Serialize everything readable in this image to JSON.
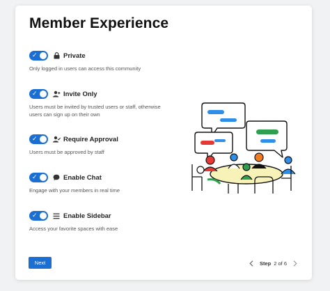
{
  "title": "Member Experience",
  "settings": [
    {
      "key": "private",
      "label": "Private",
      "icon": "lock-icon",
      "enabled": true,
      "description": "Only logged in users can access this community"
    },
    {
      "key": "invite-only",
      "label": "Invite Only",
      "icon": "user-plus-icon",
      "enabled": true,
      "description": "Users must be invited by trusted users or staff, otherwise users can sign up on their own"
    },
    {
      "key": "require-approval",
      "label": "Require Approval",
      "icon": "user-check-icon",
      "enabled": true,
      "description": "Users must be approved by staff"
    },
    {
      "key": "enable-chat",
      "label": "Enable Chat",
      "icon": "chat-bubble-icon",
      "enabled": true,
      "description": "Engage with your members in real time"
    },
    {
      "key": "enable-sidebar",
      "label": "Enable Sidebar",
      "icon": "list-icon",
      "enabled": true,
      "description": "Access your favorite spaces with ease"
    }
  ],
  "toggle_check": "✓",
  "next_label": "Next",
  "stepper": {
    "step_word": "Step",
    "count": "2 of 6"
  },
  "colors": {
    "accent": "#1b6fd3",
    "bubble_blue": "#2f8fe8",
    "bubble_red": "#e53935",
    "bubble_green": "#2e9e4f",
    "table": "#f7f2b8"
  }
}
